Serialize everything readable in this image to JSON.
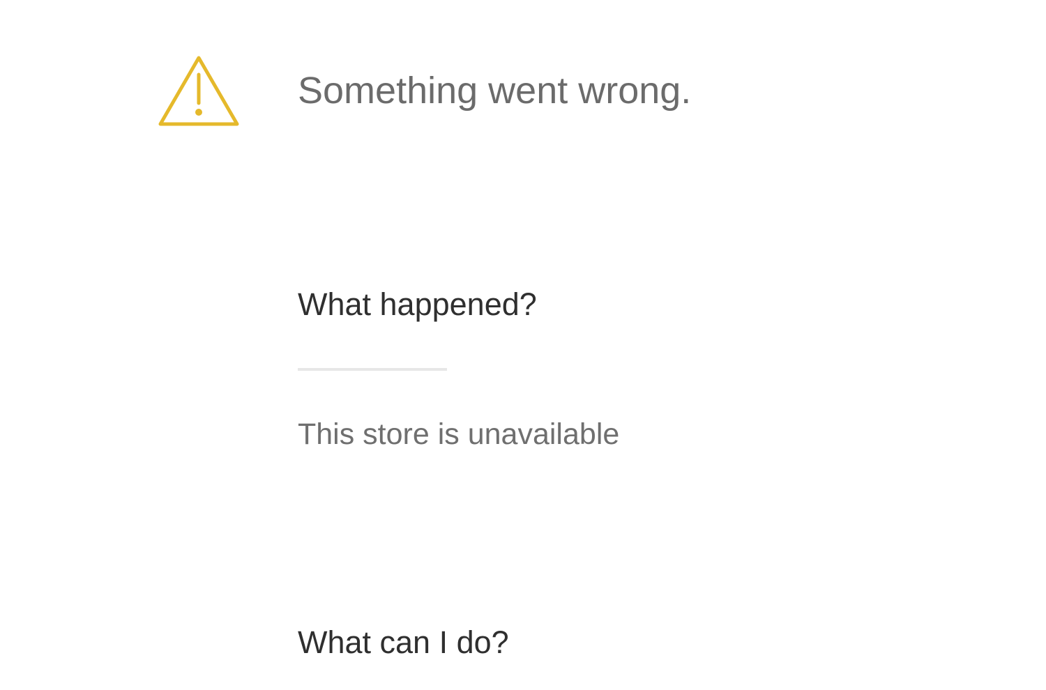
{
  "error_page": {
    "title": "Something went wrong.",
    "icon": "warning-triangle-icon",
    "what_happened": {
      "heading": "What happened?",
      "detail": "This store is unavailable"
    },
    "what_can_i_do": {
      "heading": "What can I do?"
    }
  },
  "colors": {
    "icon": "#e5b92b",
    "title": "#6b6b6b",
    "heading": "#2f2f2f",
    "detail": "#6f6f6f",
    "divider": "#e7e7e7",
    "background": "#ffffff"
  }
}
